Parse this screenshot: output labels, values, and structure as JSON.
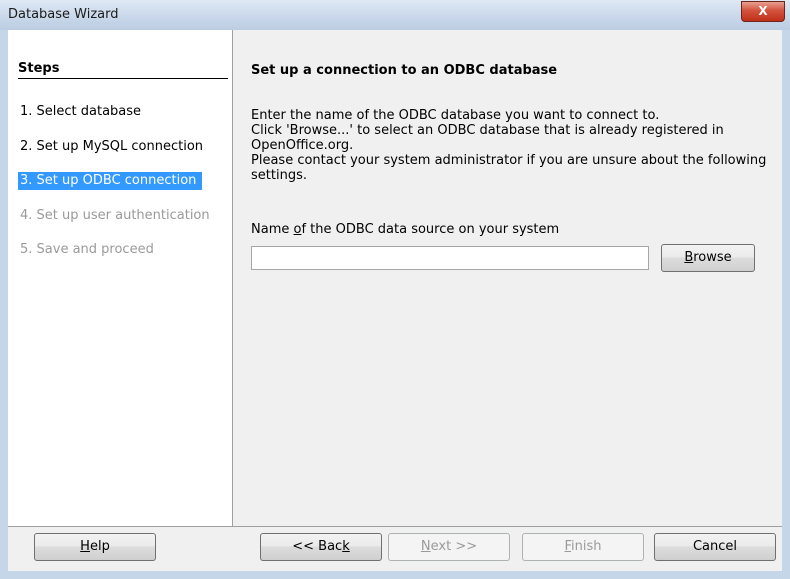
{
  "window": {
    "title": "Database Wizard",
    "close_glyph": "X"
  },
  "steps": {
    "title": "Steps",
    "items": [
      {
        "label": "1. Select database",
        "state": "normal"
      },
      {
        "label": "2. Set up MySQL connection",
        "state": "normal"
      },
      {
        "label": "3. Set up ODBC connection",
        "state": "selected"
      },
      {
        "label": "4. Set up user authentication",
        "state": "disabled"
      },
      {
        "label": "5. Save and proceed",
        "state": "disabled"
      }
    ]
  },
  "content": {
    "heading": "Set up a connection to an ODBC database",
    "description_lines": [
      "Enter the name of the ODBC database you want to connect to.",
      "Click 'Browse...' to select an ODBC database that is already registered in OpenOffice.org.",
      "Please contact your system administrator if you are unsure about the following settings."
    ],
    "field_label_pre": "Name ",
    "field_label_accel": "o",
    "field_label_post": "f the ODBC data source on your system",
    "field_value": "",
    "browse_accel": "B",
    "browse_rest": "rowse"
  },
  "footer": {
    "help_accel": "H",
    "help_rest": "elp",
    "back_pre": "<< Bac",
    "back_accel": "k",
    "next_accel": "N",
    "next_rest": "ext >>",
    "finish_accel": "F",
    "finish_rest": "inish",
    "cancel_label": "Cancel"
  },
  "colors": {
    "selection": "#3399ff",
    "disabled_text": "#9a9a9a",
    "close_button": "#c7391f"
  }
}
